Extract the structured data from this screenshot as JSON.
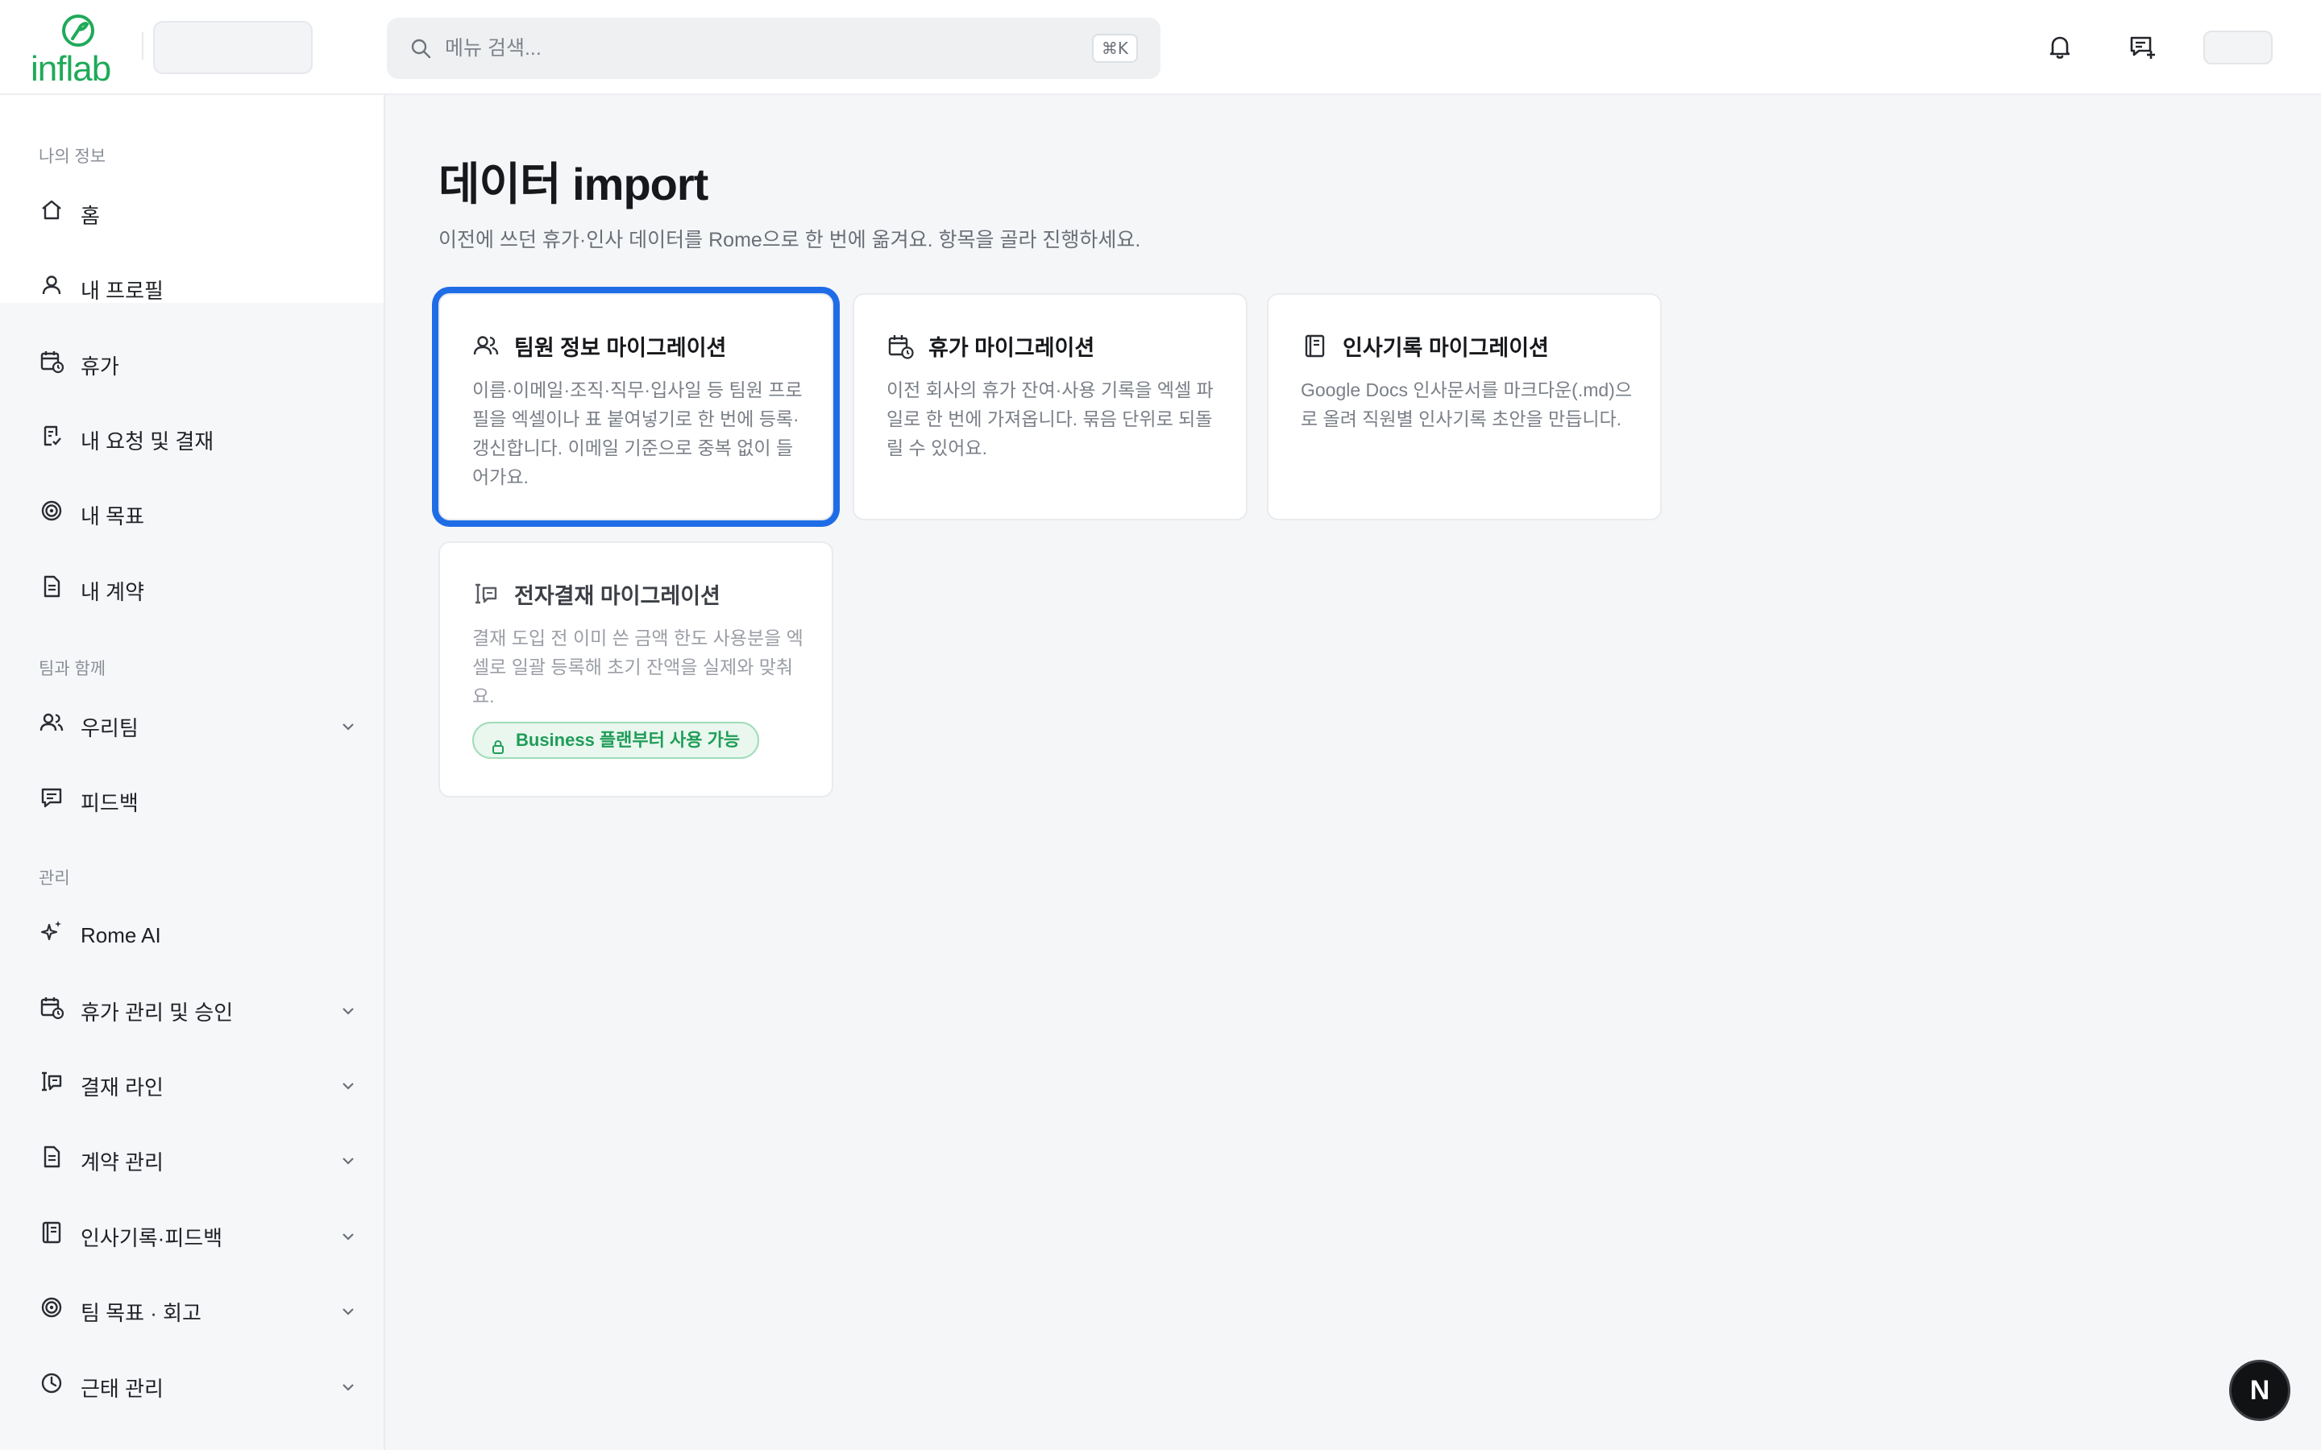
{
  "brand": {
    "logo_text": "inflab",
    "accent": "#1faa59"
  },
  "header": {
    "search_placeholder": "메뉴 검색...",
    "search_shortcut": "⌘K",
    "icons": [
      "bell-icon",
      "message-plus-icon"
    ]
  },
  "sidebar": {
    "sections": [
      {
        "label": "나의 정보",
        "items": [
          {
            "label": "홈",
            "icon": "home-icon"
          },
          {
            "label": "내 프로필",
            "icon": "user-icon"
          },
          {
            "label": "휴가",
            "icon": "calendar-clock-icon"
          },
          {
            "label": "내 요청 및 결재",
            "icon": "clipboard-icon"
          },
          {
            "label": "내 목표",
            "icon": "target-icon"
          },
          {
            "label": "내 계약",
            "icon": "document-icon"
          }
        ]
      },
      {
        "label": "팀과 함께",
        "items": [
          {
            "label": "우리팀",
            "icon": "users-icon",
            "expandable": true
          },
          {
            "label": "피드백",
            "icon": "message-icon"
          }
        ]
      },
      {
        "label": "관리",
        "items": [
          {
            "label": "Rome AI",
            "icon": "sparkles-icon"
          },
          {
            "label": "휴가 관리 및 승인",
            "icon": "calendar-clock-icon",
            "expandable": true
          },
          {
            "label": "결재 라인",
            "icon": "approval-line-icon",
            "expandable": true
          },
          {
            "label": "계약 관리",
            "icon": "document-icon",
            "expandable": true
          },
          {
            "label": "인사기록·피드백",
            "icon": "notebook-icon",
            "expandable": true
          },
          {
            "label": "팀 목표 · 회고",
            "icon": "target-icon",
            "expandable": true
          },
          {
            "label": "근태 관리",
            "icon": "clock-icon",
            "expandable": true
          }
        ]
      }
    ]
  },
  "main": {
    "title": "데이터 import",
    "description": "이전에 쓰던 휴가·인사 데이터를 Rome으로 한 번에 옮겨요. 항목을 골라 진행하세요.",
    "cards": [
      {
        "title": "팀원 정보 마이그레이션",
        "icon": "users-icon",
        "description": "이름·이메일·조직·직무·입사일 등 팀원 프로필을 엑셀이나 표 붙여넣기로 한 번에 등록·갱신합니다. 이메일 기준으로 중복 없이 들어가요.",
        "selected": true
      },
      {
        "title": "휴가 마이그레이션",
        "icon": "calendar-clock-icon",
        "description": "이전 회사의 휴가 잔여·사용 기록을 엑셀 파일로 한 번에 가져옵니다. 묶음 단위로 되돌릴 수 있어요."
      },
      {
        "title": "인사기록 마이그레이션",
        "icon": "notebook-icon",
        "description": "Google Docs 인사문서를 마크다운(.md)으로 올려 직원별 인사기록 초안을 만듭니다."
      },
      {
        "title": "전자결재 마이그레이션",
        "icon": "approval-line-icon",
        "description": "결재 도입 전 이미 쓴 금액 한도 사용분을 엑셀로 일괄 등록해 초기 잔액을 실제와 맞춰요.",
        "locked": true,
        "badge": "Business 플랜부터 사용 가능"
      }
    ]
  },
  "floating_button": {
    "label": "N"
  }
}
